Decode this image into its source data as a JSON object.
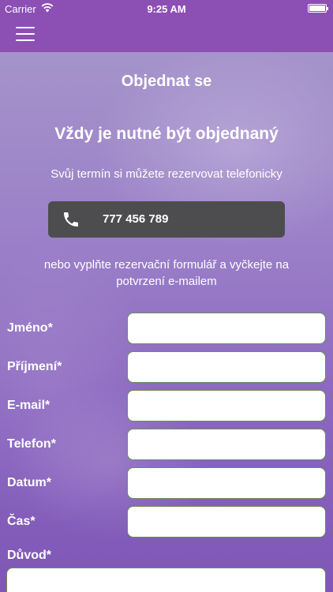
{
  "status_bar": {
    "carrier": "Carrier",
    "time": "9:25 AM"
  },
  "page": {
    "title": "Objednat se",
    "subtitle": "Vždy je nutné být objednaný",
    "info_phone": "Svůj termín si můžete rezervovat telefonicky",
    "phone_number": "777 456 789",
    "info_form": "nebo vyplňte rezervační formulář a vyčkejte na potvrzení e-mailem"
  },
  "form": {
    "first_name_label": "Jméno*",
    "first_name_value": "",
    "last_name_label": "Příjmení*",
    "last_name_value": "",
    "email_label": "E-mail*",
    "email_value": "",
    "phone_label": "Telefon*",
    "phone_value": "",
    "date_label": "Datum*",
    "date_value": "",
    "time_label": "Čas*",
    "time_value": "",
    "reason_label": "Důvod*",
    "reason_value": ""
  },
  "colors": {
    "nav_background": "#8c4fb4",
    "phone_button": "#4d4d4f",
    "input_border": "#6a8f55"
  }
}
